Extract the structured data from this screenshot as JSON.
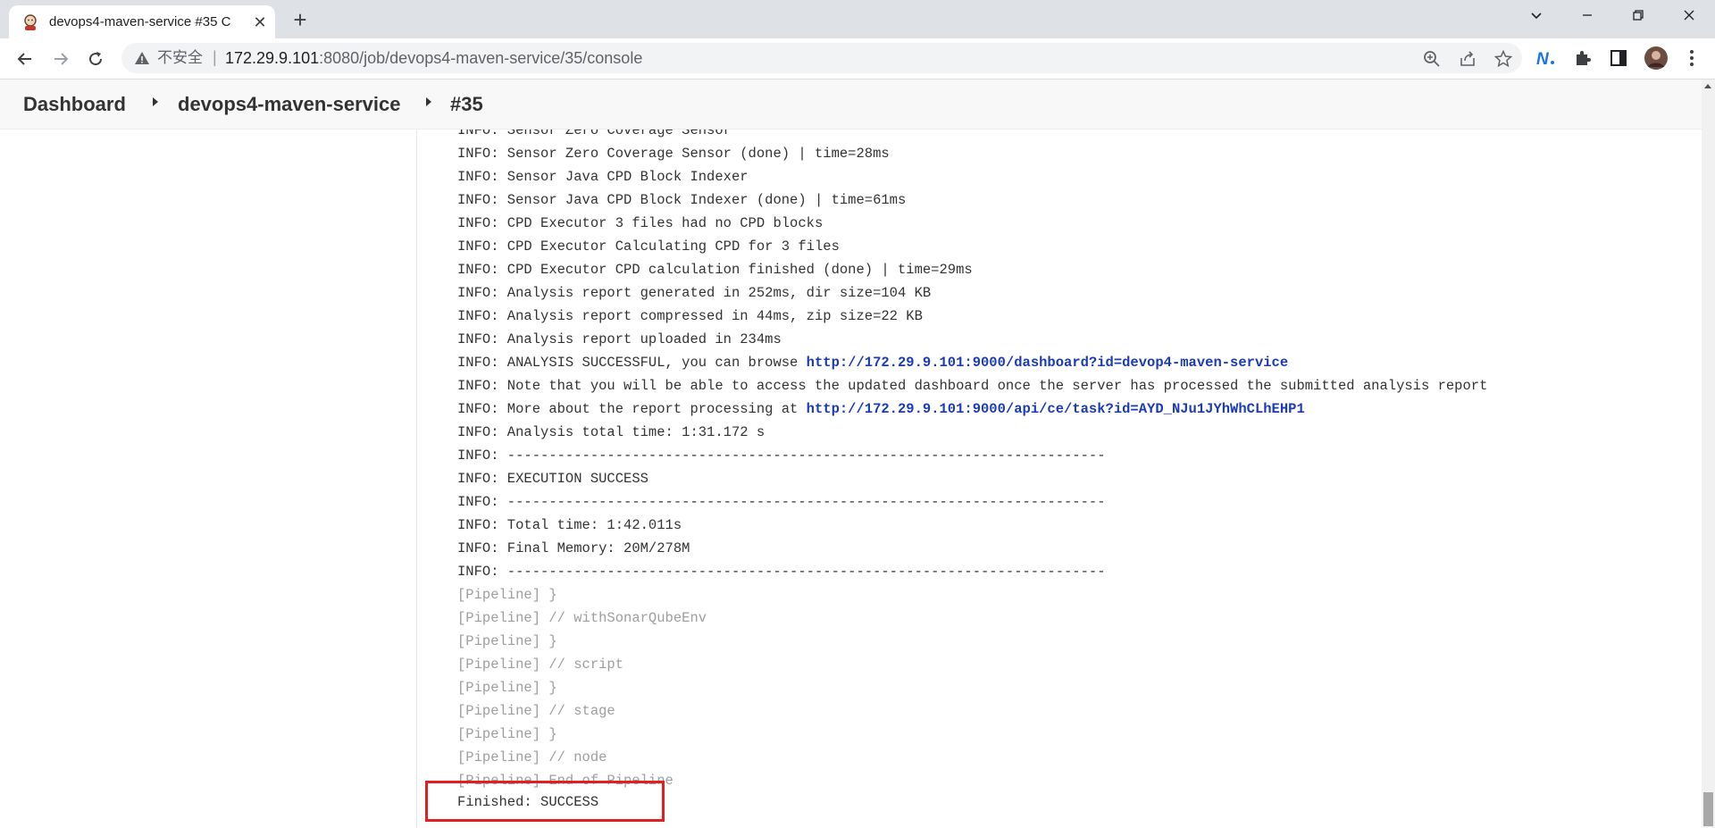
{
  "browser": {
    "tab_title": "devops4-maven-service #35 C",
    "url_insecure_label": "不安全",
    "url_separator": "|",
    "url_host": "172.29.9.101",
    "url_path": ":8080/job/devops4-maven-service/35/console"
  },
  "breadcrumb": {
    "dashboard": "Dashboard",
    "job": "devops4-maven-service",
    "build": "#35"
  },
  "console": {
    "lines": [
      {
        "type": "info",
        "text": "INFO: Sensor Zero Coverage Sensor"
      },
      {
        "type": "info",
        "text": "INFO: Sensor Zero Coverage Sensor (done) | time=28ms"
      },
      {
        "type": "info",
        "text": "INFO: Sensor Java CPD Block Indexer"
      },
      {
        "type": "info",
        "text": "INFO: Sensor Java CPD Block Indexer (done) | time=61ms"
      },
      {
        "type": "info",
        "text": "INFO: CPD Executor 3 files had no CPD blocks"
      },
      {
        "type": "info",
        "text": "INFO: CPD Executor Calculating CPD for 3 files"
      },
      {
        "type": "info",
        "text": "INFO: CPD Executor CPD calculation finished (done) | time=29ms"
      },
      {
        "type": "info",
        "text": "INFO: Analysis report generated in 252ms, dir size=104 KB"
      },
      {
        "type": "info",
        "text": "INFO: Analysis report compressed in 44ms, zip size=22 KB"
      },
      {
        "type": "info",
        "text": "INFO: Analysis report uploaded in 234ms"
      },
      {
        "type": "link",
        "text": "INFO: ANALYSIS SUCCESSFUL, you can browse ",
        "link": "http://172.29.9.101:9000/dashboard?id=devop4-maven-service"
      },
      {
        "type": "info",
        "text": "INFO: Note that you will be able to access the updated dashboard once the server has processed the submitted analysis report"
      },
      {
        "type": "link",
        "text": "INFO: More about the report processing at ",
        "link": "http://172.29.9.101:9000/api/ce/task?id=AYD_NJu1JYhWhCLhEHP1"
      },
      {
        "type": "info",
        "text": "INFO: Analysis total time: 1:31.172 s"
      },
      {
        "type": "info",
        "text": "INFO: ------------------------------------------------------------------------"
      },
      {
        "type": "info",
        "text": "INFO: EXECUTION SUCCESS"
      },
      {
        "type": "info",
        "text": "INFO: ------------------------------------------------------------------------"
      },
      {
        "type": "info",
        "text": "INFO: Total time: 1:42.011s"
      },
      {
        "type": "info",
        "text": "INFO: Final Memory: 20M/278M"
      },
      {
        "type": "info",
        "text": "INFO: ------------------------------------------------------------------------"
      },
      {
        "type": "pipeline",
        "text": "[Pipeline] }"
      },
      {
        "type": "pipeline",
        "text": "[Pipeline] // withSonarQubeEnv"
      },
      {
        "type": "pipeline",
        "text": "[Pipeline] }"
      },
      {
        "type": "pipeline",
        "text": "[Pipeline] // script"
      },
      {
        "type": "pipeline",
        "text": "[Pipeline] }"
      },
      {
        "type": "pipeline",
        "text": "[Pipeline] // stage"
      },
      {
        "type": "pipeline",
        "text": "[Pipeline] }"
      },
      {
        "type": "pipeline",
        "text": "[Pipeline] // node"
      },
      {
        "type": "pipeline",
        "text": "[Pipeline] End of Pipeline"
      }
    ],
    "finished": "Finished: SUCCESS"
  },
  "colors": {
    "link": "#1a3bb5",
    "highlight_box": "#e02020",
    "pipeline_text": "#9e9e9e"
  }
}
